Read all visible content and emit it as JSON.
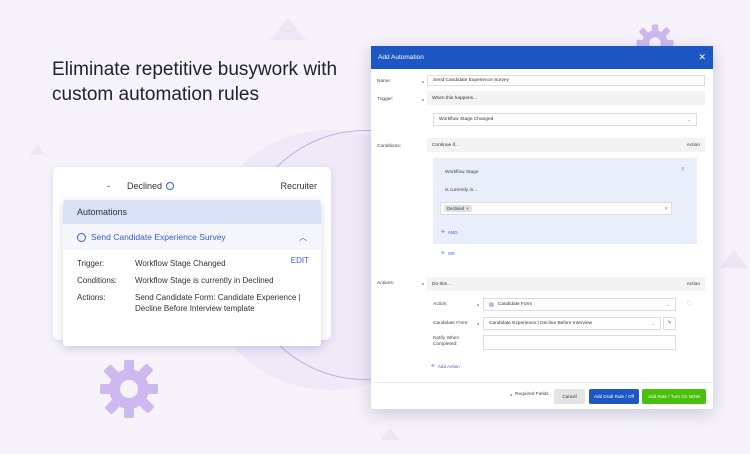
{
  "headline": "Eliminate repetitive busywork with custom automation rules",
  "card": {
    "row_dash": "-",
    "row_status": "Declined",
    "row_role": "Recruiter",
    "header": "Automations",
    "rule_name": "Send Candidate Experience Survey",
    "edit_label": "EDIT",
    "trigger_label": "Trigger:",
    "trigger_value": "Workflow Stage Changed",
    "conditions_label": "Conditions:",
    "conditions_value": "Workflow Stage is currently in Declined",
    "actions_label": "Actions:",
    "actions_value": "Send Candidate Form: Candidate Experience | Decline Before Interview template"
  },
  "modal": {
    "title": "Add Automation",
    "close": "✕",
    "name_label": "Name:",
    "name_value": "Send Candidate Experience Survey",
    "trigger_label": "Trigger:",
    "trigger_band": "When this happens...",
    "trigger_select": "Workflow Stage Changed",
    "conditions_label": "Conditions:",
    "conditions_band": "Continue if...",
    "conditions_action": "Action",
    "cond_field": "Workflow Stage",
    "cond_operator": "is currently in...",
    "cond_chip": "Declined",
    "and_label": "AND",
    "or_label": "OR",
    "actions_label": "Actions:",
    "actions_band": "Do this...",
    "actions_action": "Action",
    "action_label": "Action:",
    "action_select": "Candidate Form",
    "candidate_form_label": "Candidate Form:",
    "candidate_form_select": "Candidate Experience | Decline Before Interview",
    "notify_label": "Notify When Completed:",
    "add_action": "Add Action",
    "required_fields": "Required Fields",
    "cancel": "Cancel",
    "add_draft": "Add Draft Rule / Off",
    "add_rule": "Add Rule / Turn On NOW"
  },
  "colors": {
    "primary": "#1e56c4",
    "accent_green": "#48c00c",
    "link_blue": "#3b5bd6",
    "gear_purple": "#c9b6ee"
  }
}
